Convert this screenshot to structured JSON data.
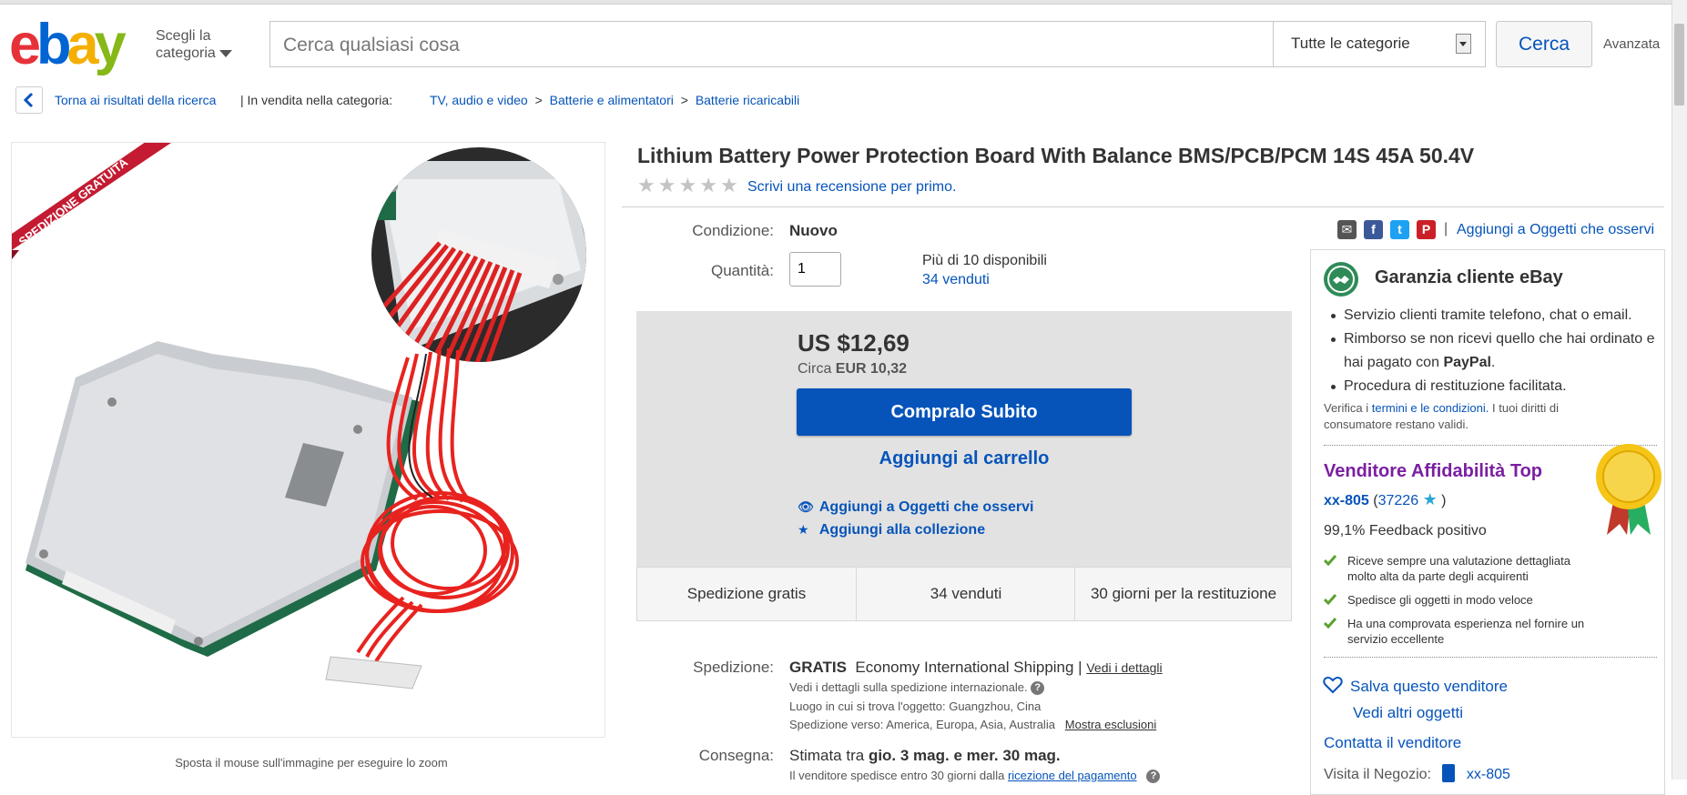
{
  "header": {
    "logo_letters": [
      "e",
      "b",
      "a",
      "y"
    ],
    "logo_colors": [
      "#e53238",
      "#0064d2",
      "#f5af02",
      "#86b817"
    ],
    "shop_by_category": "Scegli la categoria",
    "search_placeholder": "Cerca qualsiasi cosa",
    "category_select": "Tutte le categorie",
    "search_button": "Cerca",
    "advanced": "Avanzata"
  },
  "breadcrumb": {
    "back": "Torna ai risultati della ricerca",
    "sep_prefix": "| In vendita nella categoria:",
    "items": [
      "TV, audio e video",
      "Batterie e alimentatori",
      "Batterie ricaricabili"
    ],
    "separator": ">"
  },
  "image": {
    "ribbon": "SPEDIZIONE GRATUITA",
    "caption": "Sposta il mouse sull'immagine per eseguire lo zoom"
  },
  "item": {
    "title": "Lithium Battery Power Protection Board With Balance BMS/PCB/PCM 14S 45A 50.4V",
    "rating_stars": 0,
    "review_link": "Scrivi una recensione per primo.",
    "condition_label": "Condizione:",
    "condition_value": "Nuovo",
    "quantity_label": "Quantità:",
    "quantity_value": "1",
    "available": "Più di 10 disponibili",
    "sold_link": "34 venduti"
  },
  "share": {
    "icons": [
      "email-icon",
      "facebook-icon",
      "twitter-icon",
      "pinterest-icon"
    ],
    "watch": "Aggiungi a Oggetti che osservi"
  },
  "purchase": {
    "price": "US $12,69",
    "approx_prefix": "Circa",
    "approx_value": "EUR 10,32",
    "buy_now": "Compralo Subito",
    "add_cart": "Aggiungi al carrello",
    "add_watch": "Aggiungi a Oggetti che osservi",
    "add_collection": "Aggiungi alla collezione",
    "strip": [
      "Spedizione gratis",
      "34 venduti",
      "30 giorni per la restituzione"
    ]
  },
  "shipping": {
    "label": "Spedizione:",
    "free": "GRATIS",
    "method": "Economy International Shipping |",
    "details_link": "Vedi i dettagli",
    "intl_note": "Vedi i dettagli sulla spedizione internazionale.",
    "location": "Luogo in cui si trova l'oggetto:  Guangzhou, Cina",
    "ships_to": "Spedizione verso:  America, Europa, Asia, Australia",
    "exclusions_link": "Mostra esclusioni",
    "delivery_label": "Consegna:",
    "delivery_prefix": "Stimata tra",
    "delivery_value": "gio. 3 mag. e mer. 30 mag.",
    "dispatch_note": "Il venditore spedisce entro 30 giorni dalla",
    "dispatch_link": "ricezione del pagamento"
  },
  "guarantee": {
    "title": "Garanzia cliente eBay",
    "bullets": [
      "Servizio clienti tramite telefono, chat o email.",
      "Rimborso se non ricevi quello che hai ordinato e hai pagato con",
      "Procedura di restituzione facilitata."
    ],
    "paypal": "PayPal",
    "verify_prefix": "Verifica i",
    "verify_link": "termini e le condizioni.",
    "verify_suffix": "I tuoi diritti di consumatore restano validi."
  },
  "seller": {
    "badge": "Venditore Affidabilità Top",
    "name": "xx-805",
    "score": "37226",
    "feedback": "99,1% Feedback positivo",
    "points": [
      "Riceve sempre una valutazione dettagliata molto alta da parte degli acquirenti",
      "Spedisce gli oggetti in modo veloce",
      "Ha una comprovata esperienza nel fornire un servizio eccellente"
    ],
    "save": "Salva questo venditore",
    "other_items": "Vedi altri oggetti",
    "contact": "Contatta il venditore",
    "visit_store": "Visita il Negozio:",
    "store_name": "xx-805"
  }
}
